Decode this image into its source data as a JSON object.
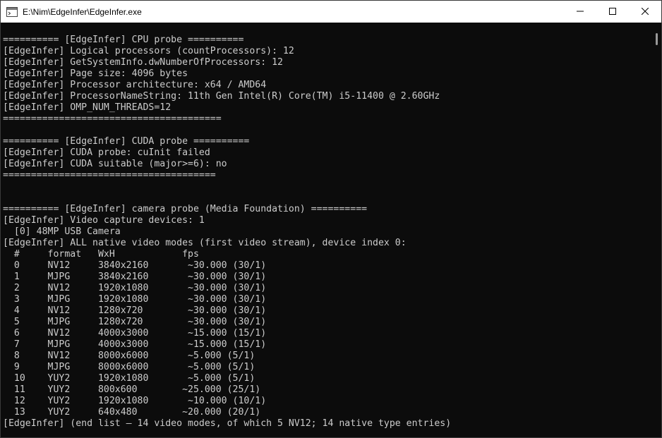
{
  "window": {
    "title": "E:\\Nim\\EdgeInfer\\EdgeInfer.exe",
    "icons": {
      "app": "console-app-icon",
      "minimize": "minimize-icon",
      "maximize": "maximize-icon",
      "close": "close-icon"
    }
  },
  "console": {
    "lines": [
      "",
      "========== [EdgeInfer] CPU probe ==========",
      "[EdgeInfer] Logical processors (countProcessors): 12",
      "[EdgeInfer] GetSystemInfo.dwNumberOfProcessors: 12",
      "[EdgeInfer] Page size: 4096 bytes",
      "[EdgeInfer] Processor architecture: x64 / AMD64",
      "[EdgeInfer] ProcessorNameString: 11th Gen Intel(R) Core(TM) i5-11400 @ 2.60GHz",
      "[EdgeInfer] OMP_NUM_THREADS=12",
      "=======================================",
      "",
      "========== [EdgeInfer] CUDA probe ==========",
      "[EdgeInfer] CUDA probe: cuInit failed",
      "[EdgeInfer] CUDA suitable (major>=6): no",
      "======================================",
      "",
      "",
      "========== [EdgeInfer] camera probe (Media Foundation) ==========",
      "[EdgeInfer] Video capture devices: 1",
      "  [0] 48MP USB Camera",
      "[EdgeInfer] ALL native video modes (first video stream), device index 0:",
      "  #     format   WxH            fps",
      "  0     NV12     3840x2160       ~30.000 (30/1)",
      "  1     MJPG     3840x2160       ~30.000 (30/1)",
      "  2     NV12     1920x1080       ~30.000 (30/1)",
      "  3     MJPG     1920x1080       ~30.000 (30/1)",
      "  4     NV12     1280x720        ~30.000 (30/1)",
      "  5     MJPG     1280x720        ~30.000 (30/1)",
      "  6     NV12     4000x3000       ~15.000 (15/1)",
      "  7     MJPG     4000x3000       ~15.000 (15/1)",
      "  8     NV12     8000x6000       ~5.000 (5/1)",
      "  9     MJPG     8000x6000       ~5.000 (5/1)",
      "  10    YUY2     1920x1080       ~5.000 (5/1)",
      "  11    YUY2     800x600        ~25.000 (25/1)",
      "  12    YUY2     1920x1080       ~10.000 (10/1)",
      "  13    YUY2     640x480        ~20.000 (20/1)",
      "[EdgeInfer] (end list — 14 video modes, of which 5 NV12; 14 native type entries)"
    ]
  }
}
